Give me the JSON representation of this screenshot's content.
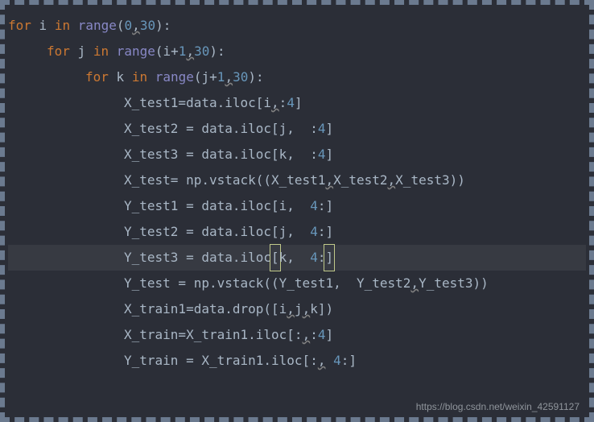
{
  "code": {
    "lines": [
      {
        "indent": 1,
        "tokens": [
          {
            "t": "kw",
            "v": "for"
          },
          {
            "t": "sp",
            "v": " "
          },
          {
            "t": "ident",
            "v": "i "
          },
          {
            "t": "kw",
            "v": "in"
          },
          {
            "t": "sp",
            "v": " "
          },
          {
            "t": "fn",
            "v": "range"
          },
          {
            "t": "punct",
            "v": "("
          },
          {
            "t": "num",
            "v": "0"
          },
          {
            "t": "squig",
            "v": ","
          },
          {
            "t": "num",
            "v": "30"
          },
          {
            "t": "punct",
            "v": "):"
          }
        ]
      },
      {
        "indent": 2,
        "tokens": [
          {
            "t": "kw",
            "v": "for"
          },
          {
            "t": "sp",
            "v": " "
          },
          {
            "t": "ident",
            "v": "j "
          },
          {
            "t": "kw",
            "v": "in"
          },
          {
            "t": "sp",
            "v": " "
          },
          {
            "t": "fn",
            "v": "range"
          },
          {
            "t": "punct",
            "v": "(i+"
          },
          {
            "t": "num",
            "v": "1"
          },
          {
            "t": "squig",
            "v": ","
          },
          {
            "t": "num",
            "v": "30"
          },
          {
            "t": "punct",
            "v": "):"
          }
        ]
      },
      {
        "indent": 3,
        "tokens": [
          {
            "t": "kw",
            "v": "for"
          },
          {
            "t": "sp",
            "v": " "
          },
          {
            "t": "ident",
            "v": "k "
          },
          {
            "t": "kw",
            "v": "in"
          },
          {
            "t": "sp",
            "v": " "
          },
          {
            "t": "fn",
            "v": "range"
          },
          {
            "t": "punct",
            "v": "(j+"
          },
          {
            "t": "num",
            "v": "1"
          },
          {
            "t": "squig",
            "v": ","
          },
          {
            "t": "num",
            "v": "30"
          },
          {
            "t": "punct",
            "v": "):"
          }
        ]
      },
      {
        "indent": 4,
        "tokens": [
          {
            "t": "ident",
            "v": "X_test1=data.iloc[i"
          },
          {
            "t": "squig",
            "v": ","
          },
          {
            "t": "punct",
            "v": ":"
          },
          {
            "t": "num",
            "v": "4"
          },
          {
            "t": "punct",
            "v": "]"
          }
        ]
      },
      {
        "indent": 4,
        "tokens": [
          {
            "t": "ident",
            "v": "X_test2 = data.iloc[j,  :"
          },
          {
            "t": "num",
            "v": "4"
          },
          {
            "t": "punct",
            "v": "]"
          }
        ]
      },
      {
        "indent": 4,
        "tokens": [
          {
            "t": "ident",
            "v": "X_test3 = data.iloc[k,  :"
          },
          {
            "t": "num",
            "v": "4"
          },
          {
            "t": "punct",
            "v": "]"
          }
        ]
      },
      {
        "indent": 4,
        "tokens": [
          {
            "t": "ident",
            "v": "X_test= np.vstack((X_test1"
          },
          {
            "t": "squig",
            "v": ","
          },
          {
            "t": "ident",
            "v": "X_test2"
          },
          {
            "t": "squig",
            "v": ","
          },
          {
            "t": "ident",
            "v": "X_test3))"
          }
        ]
      },
      {
        "indent": 4,
        "tokens": [
          {
            "t": "ident",
            "v": "Y_test1 = data.iloc[i,  "
          },
          {
            "t": "num",
            "v": "4"
          },
          {
            "t": "punct",
            "v": ":]"
          }
        ]
      },
      {
        "indent": 4,
        "tokens": [
          {
            "t": "ident",
            "v": "Y_test2 = data.iloc[j,  "
          },
          {
            "t": "num",
            "v": "4"
          },
          {
            "t": "punct",
            "v": ":]"
          }
        ]
      },
      {
        "indent": 4,
        "highlighted": true,
        "tokens": [
          {
            "t": "ident",
            "v": "Y_test3 = data.iloc"
          },
          {
            "t": "caret",
            "v": "["
          },
          {
            "t": "ident",
            "v": "k,  "
          },
          {
            "t": "num",
            "v": "4"
          },
          {
            "t": "punct",
            "v": ":"
          },
          {
            "t": "caret",
            "v": "]"
          }
        ]
      },
      {
        "indent": 4,
        "tokens": [
          {
            "t": "ident",
            "v": "Y_test = np.vstack((Y_test1,  Y_test2"
          },
          {
            "t": "squig",
            "v": ","
          },
          {
            "t": "ident",
            "v": "Y_test3))"
          }
        ]
      },
      {
        "indent": 4,
        "tokens": [
          {
            "t": "ident",
            "v": "X_train1=data.drop([i"
          },
          {
            "t": "squig",
            "v": ","
          },
          {
            "t": "ident",
            "v": "j"
          },
          {
            "t": "squig",
            "v": ","
          },
          {
            "t": "ident",
            "v": "k])"
          }
        ]
      },
      {
        "indent": 4,
        "tokens": [
          {
            "t": "ident",
            "v": "X_train=X_train1.iloc[:"
          },
          {
            "t": "squig",
            "v": ","
          },
          {
            "t": "punct",
            "v": ":"
          },
          {
            "t": "num",
            "v": "4"
          },
          {
            "t": "punct",
            "v": "]"
          }
        ]
      },
      {
        "indent": 4,
        "tokens": [
          {
            "t": "ident",
            "v": "Y_train = X_train1.iloc[:"
          },
          {
            "t": "squig",
            "v": ","
          },
          {
            "t": "sp",
            "v": " "
          },
          {
            "t": "num",
            "v": "4"
          },
          {
            "t": "punct",
            "v": ":]"
          }
        ]
      }
    ]
  },
  "watermark": "https://blog.csdn.net/weixin_42591127"
}
